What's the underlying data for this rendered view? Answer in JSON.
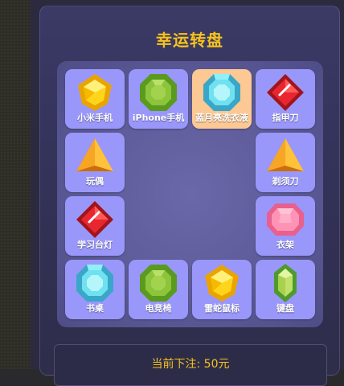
{
  "title": "幸运转盘",
  "bet_label": "当前下注: 50元",
  "active_index": 2,
  "prizes": [
    {
      "label": "小米手机",
      "icon": "yellow-gem-icon"
    },
    {
      "label": "iPhone手机",
      "icon": "green-gem-icon"
    },
    {
      "label": "蓝月亮洗衣液",
      "icon": "cyan-gem-icon"
    },
    {
      "label": "指甲刀",
      "icon": "red-gem-icon"
    },
    {
      "label": "剃须刀",
      "icon": "orange-gem-icon"
    },
    {
      "label": "衣架",
      "icon": "pink-gem-icon"
    },
    {
      "label": "键盘",
      "icon": "lime-gem-icon"
    },
    {
      "label": "雷蛇鼠标",
      "icon": "yellow-gem-icon"
    },
    {
      "label": "电竞椅",
      "icon": "green-gem-icon"
    },
    {
      "label": "书桌",
      "icon": "cyan-gem-icon"
    },
    {
      "label": "学习台灯",
      "icon": "red-gem-icon"
    },
    {
      "label": "玩偶",
      "icon": "orange-gem-icon"
    }
  ],
  "colors": {
    "accent": "#f6c21c",
    "cell": "#9a97fb",
    "cell_active": "#fcc894",
    "board": "#5d5b98"
  }
}
